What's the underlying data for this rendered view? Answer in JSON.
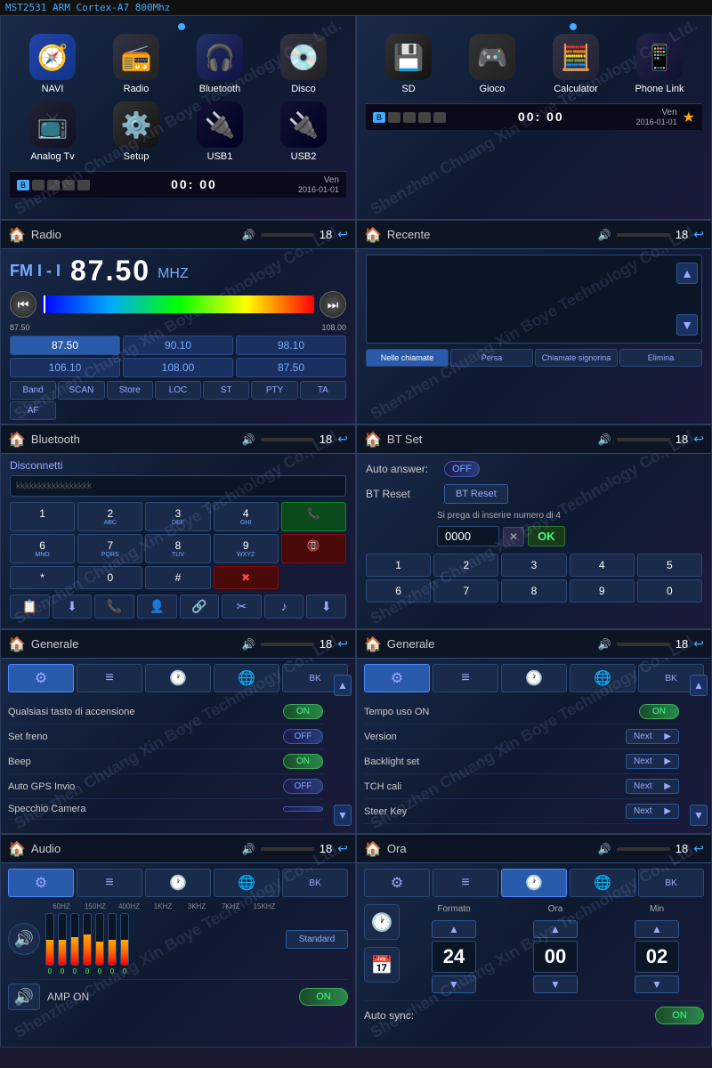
{
  "topbar": {
    "text": "MST2531 ARM Cortex-A7 800Mhz"
  },
  "home_left": {
    "icons": [
      {
        "label": "NAVI",
        "emoji": "🧭",
        "class": "icon-navi"
      },
      {
        "label": "Radio",
        "emoji": "📻",
        "class": "icon-radio"
      },
      {
        "label": "Bluetooth",
        "emoji": "🎧",
        "class": "icon-bt"
      },
      {
        "label": "Disco",
        "emoji": "💿",
        "class": "icon-dvd"
      },
      {
        "label": "Analog Tv",
        "emoji": "📺",
        "class": "icon-tv"
      },
      {
        "label": "Setup",
        "emoji": "⚙️",
        "class": "icon-setup"
      },
      {
        "label": "USB1",
        "emoji": "🔌",
        "class": "icon-usb"
      },
      {
        "label": "USB2",
        "emoji": "🔌",
        "class": "icon-usb2"
      }
    ],
    "status": {
      "time": "00: 00",
      "day": "Ven",
      "date": "2016-01-01"
    }
  },
  "home_right": {
    "icons": [
      {
        "label": "SD",
        "emoji": "💾",
        "class": "icon-sd"
      },
      {
        "label": "Gioco",
        "emoji": "🎮",
        "class": "icon-game"
      },
      {
        "label": "Calculator",
        "emoji": "🧮",
        "class": "icon-calc"
      },
      {
        "label": "Phone Link",
        "emoji": "📱",
        "class": "icon-phone"
      }
    ],
    "status": {
      "time": "00: 00",
      "day": "Ven",
      "date": "2016-01-01",
      "star": "★"
    }
  },
  "radio": {
    "title": "Radio",
    "band": "FM I - I",
    "freq": "87.50",
    "unit": "MHZ",
    "range_min": "87.50",
    "range_max": "108.00",
    "presets": [
      "87.50",
      "90.10",
      "98.10",
      "106.10",
      "108.00",
      "87.50"
    ],
    "controls": [
      "Band",
      "SCAN",
      "Store",
      "LOC",
      "ST",
      "PTY",
      "TA",
      "AF"
    ],
    "num": "18"
  },
  "recente": {
    "title": "Recente",
    "num": "18",
    "tabs": [
      "Nelle chiamate",
      "Persa",
      "Chiamate signorina",
      "Elimina"
    ]
  },
  "bluetooth": {
    "title": "Bluetooth",
    "num": "18",
    "disconnetti": "Disconnetti",
    "device": "kkkkkkkkkkkkkkkkk",
    "numpad": [
      {
        "num": "1",
        "sub": ""
      },
      {
        "num": "2",
        "sub": "ABC"
      },
      {
        "num": "3",
        "sub": "DEF"
      },
      {
        "num": "4",
        "sub": "GHI"
      },
      {
        "num": "☎",
        "sub": "",
        "class": "green"
      },
      {
        "num": "6",
        "sub": "MNO"
      },
      {
        "num": "7",
        "sub": "PQRS"
      },
      {
        "num": "8",
        "sub": "TUV"
      },
      {
        "num": "9",
        "sub": "WXYZ"
      },
      {
        "num": "✖",
        "sub": "",
        "class": "red"
      },
      {
        "num": "*",
        "sub": ""
      },
      {
        "num": "0",
        "sub": ""
      },
      {
        "num": "#",
        "sub": ""
      },
      {
        "num": "📞",
        "sub": "",
        "class": "red"
      }
    ],
    "actions": [
      "📋",
      "⬇",
      "📞",
      "👤",
      "🔗",
      "✂",
      "♪",
      "⬇"
    ]
  },
  "btset": {
    "title": "BT Set",
    "num": "18",
    "auto_answer_label": "Auto answer:",
    "auto_answer_value": "OFF",
    "bt_reset_label": "BT Reset",
    "bt_reset_btn": "BT Reset",
    "note": "Si prega di inserire numero di 4",
    "pin": "0000",
    "numpad": [
      "1",
      "2",
      "3",
      "4",
      "5",
      "6",
      "7",
      "8",
      "9",
      "0"
    ]
  },
  "generale_left": {
    "title": "Generale",
    "num": "18",
    "tabs": [
      "⚙",
      "≡",
      "🕐",
      "🌐",
      "BK"
    ],
    "rows": [
      {
        "label": "Qualsiasi tasto di accensione",
        "toggle": "ON"
      },
      {
        "label": "Set freno",
        "toggle": "OFF"
      },
      {
        "label": "Beep",
        "toggle": "ON"
      },
      {
        "label": "Auto GPS Invio",
        "toggle": "OFF"
      },
      {
        "label": "Specchio Camera",
        "toggle": ""
      }
    ]
  },
  "generale_right": {
    "title": "Generale",
    "num": "18",
    "tabs": [
      "⚙",
      "≡",
      "🕐",
      "🌐",
      "BK"
    ],
    "rows": [
      {
        "label": "Tempo uso ON",
        "value": "ON"
      },
      {
        "label": "Version",
        "value": "Next"
      },
      {
        "label": "Backlight set",
        "value": "Next"
      },
      {
        "label": "TCH cali",
        "value": "Next"
      },
      {
        "label": "Steer Key",
        "value": "Next"
      }
    ]
  },
  "audio": {
    "title": "Audio",
    "num": "18",
    "tabs": [
      "⚙",
      "≡",
      "🕐",
      "🌐",
      "BK"
    ],
    "eq_labels": [
      "60HZ",
      "150HZ",
      "400HZ",
      "1KHZ",
      "3KHZ",
      "7KHZ",
      "15KHZ"
    ],
    "eq_values": [
      50,
      50,
      55,
      60,
      45,
      50,
      50
    ],
    "eq_nums": [
      "0",
      "0",
      "0",
      "0",
      "0",
      "0",
      "0"
    ],
    "preset": "Standard",
    "amp_label": "AMP ON",
    "amp_toggle": "ON"
  },
  "ora": {
    "title": "Ora",
    "num": "18",
    "tabs": [
      "⚙",
      "≡",
      "🕐",
      "🌐",
      "BK"
    ],
    "formato_label": "Formato",
    "ora_label": "Ora",
    "min_label": "Min",
    "formato_value": "24",
    "ora_value": "00",
    "min_value": "02",
    "sync_label": "Auto sync:",
    "sync_value": "ON"
  },
  "watermark": "Shenzhen Chuang Xin Boye Technology Co., Ltd."
}
